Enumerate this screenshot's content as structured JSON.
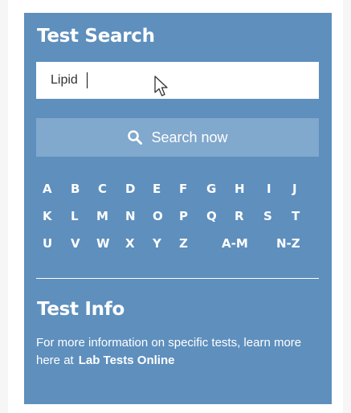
{
  "search": {
    "title": "Test Search",
    "input_value": "Lipid",
    "button_label": "Search now"
  },
  "alphabet": {
    "rows": [
      [
        "A",
        "B",
        "C",
        "D",
        "E",
        "F",
        "G",
        "H",
        "I",
        "J"
      ],
      [
        "K",
        "L",
        "M",
        "N",
        "O",
        "P",
        "Q",
        "R",
        "S",
        "T"
      ],
      [
        "U",
        "V",
        "W",
        "X",
        "Y",
        "Z"
      ]
    ],
    "ranges": [
      "A-M",
      "N-Z"
    ]
  },
  "info": {
    "title": "Test Info",
    "text": "For more information on specific tests, learn more here at",
    "link_label": "Lab Tests Online"
  },
  "colors": {
    "panel": "#5e8fbd",
    "button": "#81a8cd",
    "text": "#ffffff"
  },
  "icons": [
    "search-icon",
    "mouse-cursor-icon"
  ]
}
